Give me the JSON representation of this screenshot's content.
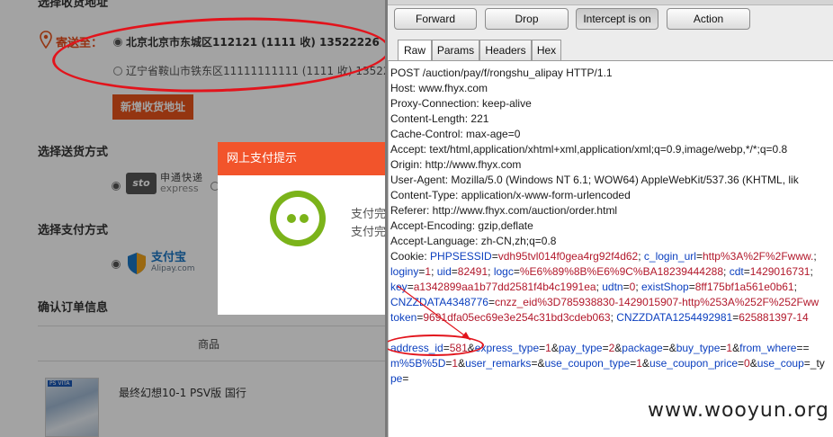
{
  "shop": {
    "address_section_title": "选择收货地址",
    "send_to_label": "寄送至：",
    "address_1": "北京北京市东城区112121 (1111 收) 13522226",
    "address_2": "辽宁省鞍山市铁东区11111111111 (1111 收) 13522",
    "add_address_button": "新增收货地址",
    "shipping_title": "选择送货方式",
    "shipping_logo": "sto",
    "shipping_name_cn": "申通快递",
    "shipping_name_en": "express",
    "payment_title": "选择支付方式",
    "alipay_name_cn": "支付宝",
    "alipay_name_en": "Alipay.com",
    "order_info_title": "确认订单信息",
    "column_product": "商品",
    "product_name": "最终幻想10-1 PSV版 国行",
    "product_image_tag": "PS VITA"
  },
  "modal": {
    "title": "网上支付提示",
    "line1": "支付完",
    "line2": "支付完"
  },
  "burp": {
    "buttons": {
      "forward": "Forward",
      "drop": "Drop",
      "intercept": "Intercept is on",
      "action": "Action"
    },
    "tabs": [
      "Raw",
      "Params",
      "Headers",
      "Hex"
    ],
    "request_lines": [
      "POST /auction/pay/f/rongshu_alipay HTTP/1.1",
      "Host: www.fhyx.com",
      "Proxy-Connection: keep-alive",
      "Content-Length: 221",
      "Cache-Control: max-age=0",
      "Accept: text/html,application/xhtml+xml,application/xml;q=0.9,image/webp,*/*;q=0.8",
      "Origin: http://www.fhyx.com",
      "User-Agent: Mozilla/5.0 (Windows NT 6.1; WOW64) AppleWebKit/537.36 (KHTML, lik",
      "Content-Type: application/x-www-form-urlencoded",
      "Referer: http://www.fhyx.com/auction/order.html",
      "Accept-Encoding: gzip,deflate",
      "Accept-Language: zh-CN,zh;q=0.8"
    ],
    "cookie_label": "Cookie: ",
    "cookie_lines": [
      [
        [
          "PHPSESSID",
          "vdh95tvl014f0gea4rg92f4d62"
        ],
        [
          "c_login_url",
          "http%3A%2F%2Fwww."
        ]
      ],
      [
        [
          "loginy",
          "1"
        ],
        [
          "uid",
          "82491"
        ],
        [
          "logc",
          "%E6%89%8B%E6%9C%BA18239444288"
        ],
        [
          "cdt",
          "1429016731"
        ]
      ],
      [
        [
          "key",
          "a1342899aa1b77dd2581f4b4c1991ea"
        ],
        [
          "udtn",
          "0"
        ],
        [
          "existShop",
          "8ff175bf1a561e0b61"
        ]
      ],
      [
        [
          "CNZZDATA4348776",
          "cnzz_eid%3D785938830-1429015907-http%253A%252F%252Fww"
        ]
      ],
      [
        [
          "token",
          "9691dfa05ec69e3e254c31bd3cdeb063"
        ],
        [
          "CNZZDATA1254492981",
          "625881397-14"
        ]
      ]
    ],
    "body_lines": [
      [
        [
          "address_id",
          "581"
        ],
        [
          "express_type",
          "1"
        ],
        [
          "pay_type",
          "2"
        ],
        [
          "package",
          ""
        ],
        [
          "buy_type",
          "1"
        ],
        [
          "from_where",
          ""
        ]
      ],
      [
        [
          "m%5B%5D",
          "1"
        ],
        [
          "user_remarks",
          ""
        ],
        [
          "use_coupon_type",
          "1"
        ],
        [
          "use_coupon_price",
          "0"
        ],
        [
          "use_coup",
          ""
        ]
      ],
      [
        [
          "pe",
          ""
        ]
      ]
    ]
  },
  "watermark": "www.wooyun.org",
  "colors": {
    "accent_orange": "#e8541c",
    "modal_header": "#f2542b",
    "annotation_red": "#e2141c",
    "param_name": "#0b3fbf",
    "param_value": "#b2182b",
    "alipay_blue": "#1a76c4",
    "success_green": "#7bb31a"
  }
}
